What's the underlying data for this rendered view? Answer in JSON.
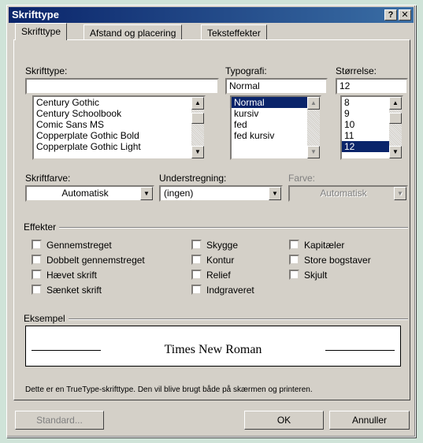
{
  "window": {
    "title": "Skrifttype",
    "help_btn": "?",
    "close_btn": "✕"
  },
  "tabs": [
    {
      "label": "Skrifttype",
      "active": true
    },
    {
      "label": "Afstand og placering",
      "active": false
    },
    {
      "label": "Teksteffekter",
      "active": false
    }
  ],
  "font": {
    "label": "Skrifttype:",
    "value": "",
    "list": [
      "Century Gothic",
      "Century Schoolbook",
      "Comic Sans MS",
      "Copperplate Gothic Bold",
      "Copperplate Gothic Light"
    ]
  },
  "style": {
    "label": "Typografi:",
    "value": "Normal",
    "list": [
      "Normal",
      "kursiv",
      "fed",
      "fed kursiv"
    ],
    "selected": "Normal"
  },
  "size": {
    "label": "Størrelse:",
    "value": "12",
    "list": [
      "8",
      "9",
      "10",
      "11",
      "12"
    ],
    "selected": "12"
  },
  "font_color": {
    "label": "Skriftfarve:",
    "value": "Automatisk"
  },
  "underline": {
    "label": "Understregning:",
    "value": "(ingen)"
  },
  "underline_color": {
    "label": "Farve:",
    "value": "Automatisk"
  },
  "effects": {
    "label": "Effekter",
    "col1": [
      "Gennemstreget",
      "Dobbelt gennemstreget",
      "Hævet skrift",
      "Sænket skrift"
    ],
    "col2": [
      "Skygge",
      "Kontur",
      "Relief",
      "Indgraveret"
    ],
    "col3": [
      "Kapitæler",
      "Store bogstaver",
      "Skjult"
    ]
  },
  "preview": {
    "label": "Eksempel",
    "sample": "Times New Roman",
    "note": "Dette er en TrueType-skrifttype. Den vil blive brugt både på skærmen og printeren."
  },
  "buttons": {
    "default": "Standard...",
    "ok": "OK",
    "cancel": "Annuller"
  }
}
